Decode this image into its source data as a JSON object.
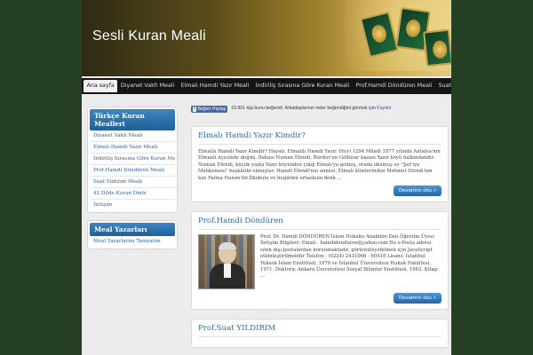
{
  "site": {
    "title": "Sesli Kuran Meali"
  },
  "nav": {
    "items": [
      {
        "label": "Ana sayfa"
      },
      {
        "label": "Diyanet Vakfı Meali"
      },
      {
        "label": "Elmalı Hamdi Yazır Meali"
      },
      {
        "label": "İndiriliş Sırasına Göre Kuran Meali"
      },
      {
        "label": "Prof.Hamdi Döndüren Meali"
      },
      {
        "label": "Suat Yıldırım Meali"
      }
    ]
  },
  "sidebar": {
    "widget1": {
      "title": "Türkçe Kuran Mealleri",
      "items": [
        "Diyanet Vakfı Meali",
        "Elmalı Hamdi Yazır Meali",
        "İndiriliş Sırasına Göre Kuran Meali",
        "Prof.Hamdi Döndüren Meali",
        "Suat Yıldırım Meali",
        "42 Dilde Kuran Dinle",
        "İletişim"
      ]
    },
    "widget2": {
      "title": "Meal Yazarları",
      "items": [
        "Meal Yazarlarını Tanıyalım"
      ]
    }
  },
  "social": {
    "button_label": "Beğen",
    "share_label": "Paylaş",
    "text_main": "19.901 kişi bunu beğendi.",
    "text_cont": "Arkadaşlarının neler beğendiğini görmek için",
    "link_label": "Kaydol."
  },
  "posts": [
    {
      "title": "Elmalı Hamdi Yazır Kimdir?",
      "body": "Elmalılı Hamdi Yazır Kimdir? Hayatı. Elmalılı Hamdi Yazır, Hicri 1294 Miladi 1877 yılında Antalya'nın Elmalılı ilçesinde doğdu. Babası Numan Efendi, Burdur'un Gölhisar kazası Yazır köyü halkındandır. Numan Efendi, küçük yaşta Yazır köyünden çıkıp Elmalı'ya gelmiş, orada okumuş ve \"Şer'iye Mahkemesi\" başkâtibi olmuştur. Hamdi Efendi'nin annesi, Elmalı âlimlerinden Mehmet Efendi'nin kızı Fatma Hanım'dır.İlkokulu ve bugünkü ortaokula denk ...",
      "more_label": "Devamını oku »"
    },
    {
      "title": "Prof.Hamdi Döndüren",
      "body": "Prof. Dr. Hamdi DÖNDÜREN İslam Hukuku Anabilim Dalı Öğretim Üyesi İletişim Bilgileri: Email : hamdidonduren@yahoo.com Bu e-Posta adresi istek dışı postalardan korunmaktadır, görüntüleyebilmek için JavaScript etkinleştirilmelidir Telefon : (0224) 2431066 - 60418 Lisans: İstanbul Yüksek İslam Enstitüsü, 1970 ve İstanbul Üniversitesi Hukuk Fakültesi, 1971. Doktora: Ankara Üniversitesi Sosyal Bilimler Enstitüsü, 1983. Kitap: ...",
      "more_label": "Devamını oku »"
    },
    {
      "title": "Prof.Suat YILDIRIM"
    }
  ]
}
